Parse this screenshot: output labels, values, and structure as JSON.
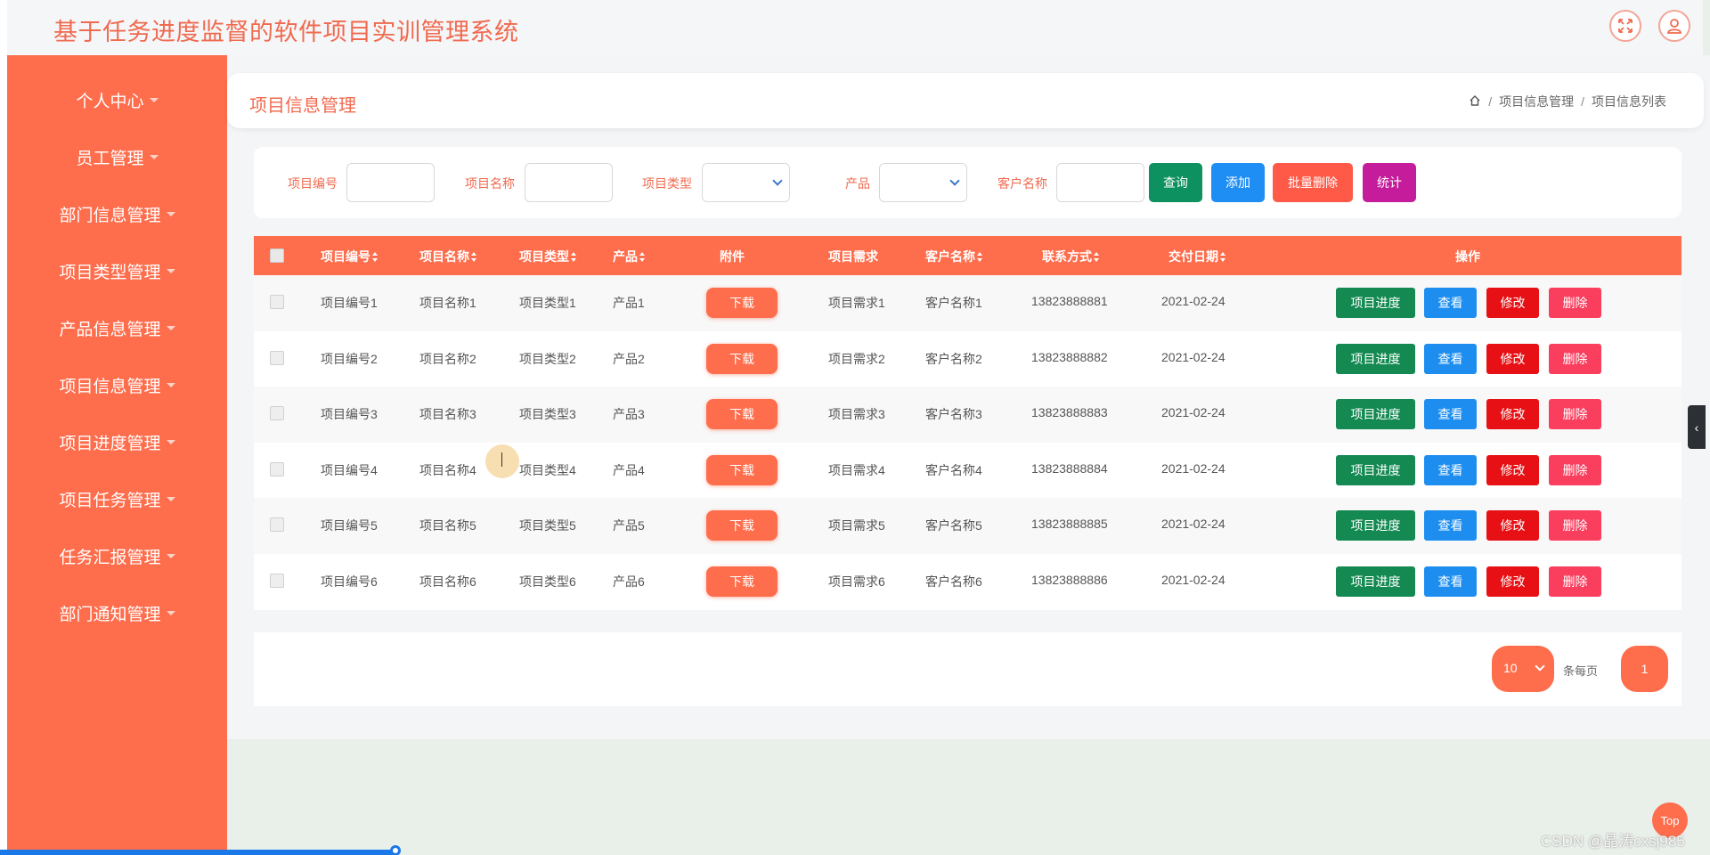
{
  "app": {
    "title": "基于任务进度监督的软件项目实训管理系统"
  },
  "topbar": {
    "icons": [
      "fullscreen-icon",
      "user-icon"
    ]
  },
  "sidebar": {
    "items": [
      {
        "label": "个人中心"
      },
      {
        "label": "员工管理"
      },
      {
        "label": "部门信息管理"
      },
      {
        "label": "项目类型管理"
      },
      {
        "label": "产品信息管理"
      },
      {
        "label": "项目信息管理"
      },
      {
        "label": "项目进度管理"
      },
      {
        "label": "项目任务管理"
      },
      {
        "label": "任务汇报管理"
      },
      {
        "label": "部门通知管理"
      }
    ]
  },
  "page": {
    "title": "项目信息管理",
    "breadcrumb": [
      "项目信息管理",
      "项目信息列表"
    ]
  },
  "search": {
    "project_no_label": "项目编号",
    "project_name_label": "项目名称",
    "project_type_label": "项目类型",
    "product_label": "产品",
    "customer_label": "客户名称",
    "query_btn": "查询",
    "add_btn": "添加",
    "batch_delete_btn": "批量删除",
    "stats_btn": "统计",
    "colors": {
      "query": "#0d9160",
      "add": "#1e8ef4",
      "batch_delete": "#ff5a48",
      "stats": "#c41c9a"
    }
  },
  "table": {
    "headers": {
      "project_no": "项目编号",
      "project_name": "项目名称",
      "project_type": "项目类型",
      "product": "产品",
      "attachment": "附件",
      "requirement": "项目需求",
      "customer": "客户名称",
      "contact": "联系方式",
      "delivery_date": "交付日期",
      "actions": "操作"
    },
    "rows": [
      {
        "project_no": "项目编号1",
        "project_name": "项目名称1",
        "project_type": "项目类型1",
        "product": "产品1",
        "download": "下载",
        "requirement": "项目需求1",
        "customer": "客户名称1",
        "contact": "13823888881",
        "delivery_date": "2021-02-24"
      },
      {
        "project_no": "项目编号2",
        "project_name": "项目名称2",
        "project_type": "项目类型2",
        "product": "产品2",
        "download": "下载",
        "requirement": "项目需求2",
        "customer": "客户名称2",
        "contact": "13823888882",
        "delivery_date": "2021-02-24"
      },
      {
        "project_no": "项目编号3",
        "project_name": "项目名称3",
        "project_type": "项目类型3",
        "product": "产品3",
        "download": "下载",
        "requirement": "项目需求3",
        "customer": "客户名称3",
        "contact": "13823888883",
        "delivery_date": "2021-02-24"
      },
      {
        "project_no": "项目编号4",
        "project_name": "项目名称4",
        "project_type": "项目类型4",
        "product": "产品4",
        "download": "下载",
        "requirement": "项目需求4",
        "customer": "客户名称4",
        "contact": "13823888884",
        "delivery_date": "2021-02-24"
      },
      {
        "project_no": "项目编号5",
        "project_name": "项目名称5",
        "project_type": "项目类型5",
        "product": "产品5",
        "download": "下载",
        "requirement": "项目需求5",
        "customer": "客户名称5",
        "contact": "13823888885",
        "delivery_date": "2021-02-24"
      },
      {
        "project_no": "项目编号6",
        "project_name": "项目名称6",
        "project_type": "项目类型6",
        "product": "产品6",
        "download": "下载",
        "requirement": "项目需求6",
        "customer": "客户名称6",
        "contact": "13823888886",
        "delivery_date": "2021-02-24"
      }
    ],
    "actions": {
      "progress": "项目进度",
      "view": "查看",
      "edit": "修改",
      "delete": "删除"
    }
  },
  "pagination": {
    "page_size": "10",
    "page_size_label": "条每页",
    "current_page": "1"
  },
  "misc": {
    "top_button": "Top",
    "watermark": "CSDN @晶涛cxsj985",
    "side_toggle_icon": "chevron-left-icon"
  }
}
